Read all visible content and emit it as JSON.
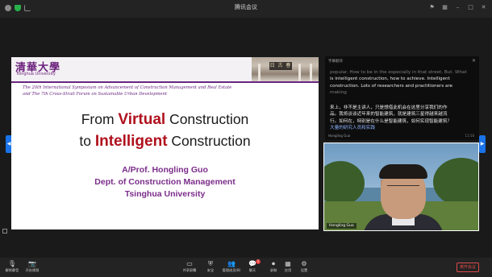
{
  "window": {
    "title": "腾讯会议"
  },
  "slide": {
    "logo_cn": "清華大學",
    "logo_en": "Tsinghua University",
    "plaque": "日 古 春",
    "symposium_line1": "The 20th International Symposium on Advancement of Construction Management and Real Estate",
    "symposium_line2": "and The 7th Cross-Strait Forum on Sustainable Urban Development",
    "title_from": "From ",
    "title_virtual": "Virtual",
    "title_construction1": " Construction",
    "title_to": "to ",
    "title_intelligent": "Intelligent",
    "title_construction2": " Construction",
    "author": "A/Prof. Hongling Guo",
    "dept": "Dept. of Construction Management",
    "university": "Tsinghua University"
  },
  "captions": {
    "header": "字幕翻译",
    "en_line1_dim": "popular. How to be in the especially in that street. But. What",
    "en_line2": "is intelligent construction, how to achieve. Intelligent",
    "en_line3": "construction. Lots of researchers and practitioners are",
    "en_line4": "making",
    "zh_line1": "来上，非不是主讲人，只是想借此机会在这里分享我们的作",
    "zh_line2": "品。我将谈谈近年来的智能建筑，就是建筑三星得越来越流",
    "zh_line3": "行。如何在，特别是在什么是智能建筑，如何实现智能建筑？",
    "zh_line4": "大量的研究人员和实践",
    "speaker": "Hongling Guo",
    "time": "11:58"
  },
  "video": {
    "name_tag": "Hongling Guo"
  },
  "toolbar": {
    "mic_label": "解除静音",
    "video_label": "开启视频",
    "share_label": "共享屏幕",
    "security_label": "安全",
    "members_label": "管理成员(8)",
    "chat_label": "聊天",
    "record_label": "录制",
    "apps_label": "应用",
    "settings_label": "设置",
    "end_label": "离开会议",
    "members_badge": "1"
  }
}
